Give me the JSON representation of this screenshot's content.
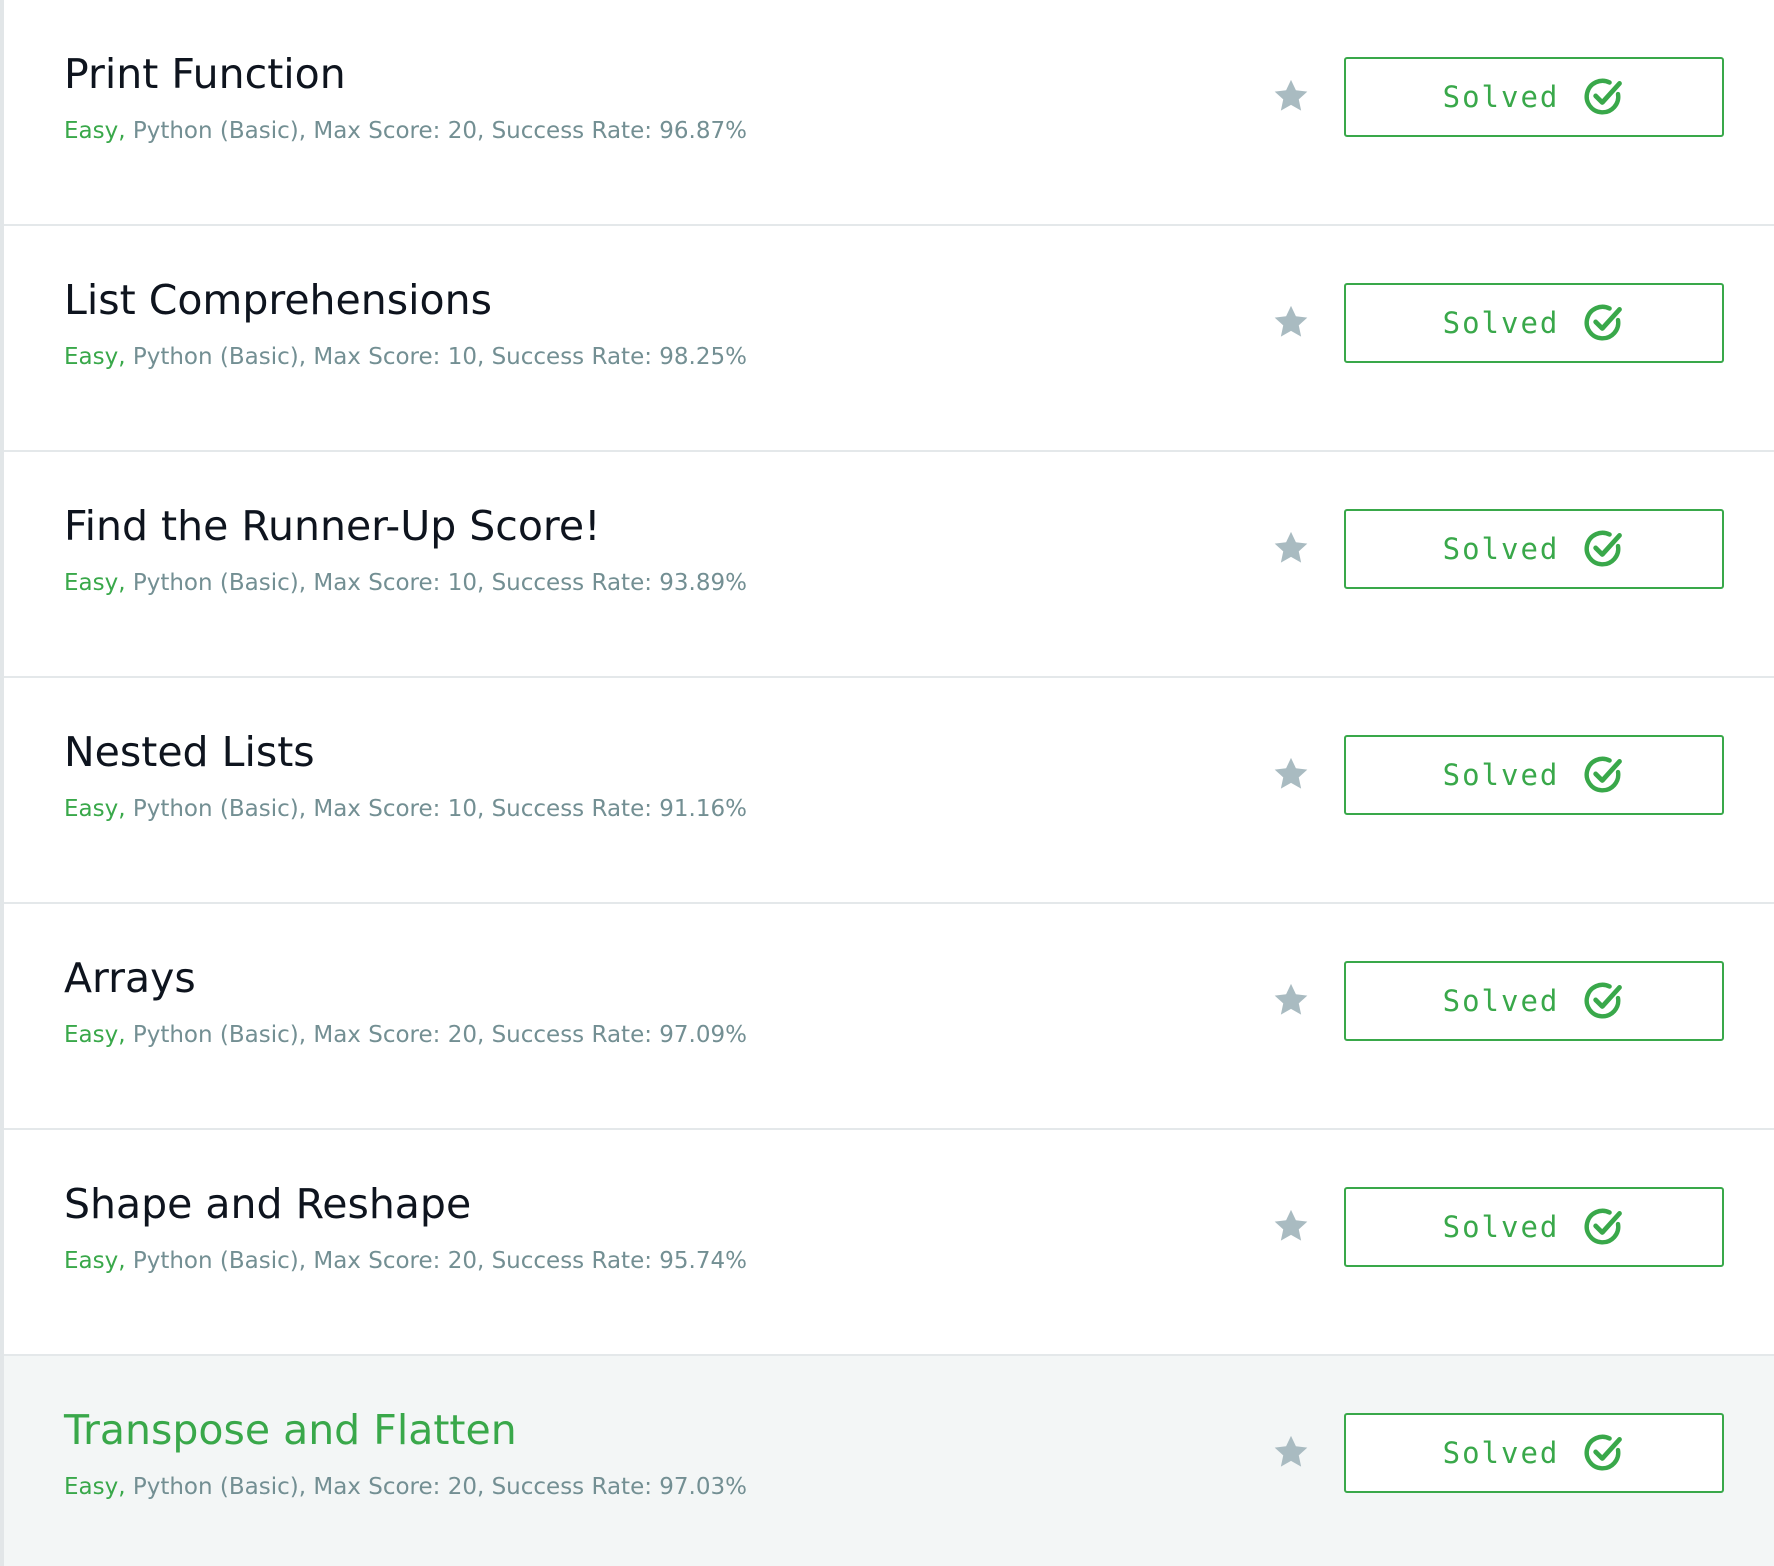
{
  "colors": {
    "accent_green": "#39a84a",
    "meta_gray": "#738f93",
    "title_dark": "#0e141e",
    "star_gray": "#a9bbc1",
    "hover_row_bg": "#f3f6f6"
  },
  "icons": {
    "star": "star-icon",
    "check": "check-circle-icon"
  },
  "challenges": [
    {
      "name": "Print Function",
      "difficulty": "Easy,",
      "details": " Python (Basic), Max Score: 20, Success Rate: 96.87%",
      "status": "Solved"
    },
    {
      "name": "List Comprehensions",
      "difficulty": "Easy,",
      "details": " Python (Basic), Max Score: 10, Success Rate: 98.25%",
      "status": "Solved"
    },
    {
      "name": "Find the Runner-Up Score!",
      "difficulty": "Easy,",
      "details": " Python (Basic), Max Score: 10, Success Rate: 93.89%",
      "status": "Solved"
    },
    {
      "name": "Nested Lists",
      "difficulty": "Easy,",
      "details": " Python (Basic), Max Score: 10, Success Rate: 91.16%",
      "status": "Solved"
    },
    {
      "name": "Arrays",
      "difficulty": "Easy,",
      "details": " Python (Basic), Max Score: 20, Success Rate: 97.09%",
      "status": "Solved"
    },
    {
      "name": "Shape and Reshape",
      "difficulty": "Easy,",
      "details": " Python (Basic), Max Score: 20, Success Rate: 95.74%",
      "status": "Solved"
    },
    {
      "name": "Transpose and Flatten",
      "difficulty": "Easy,",
      "details": " Python (Basic), Max Score: 20, Success Rate: 97.03%",
      "status": "Solved"
    }
  ]
}
